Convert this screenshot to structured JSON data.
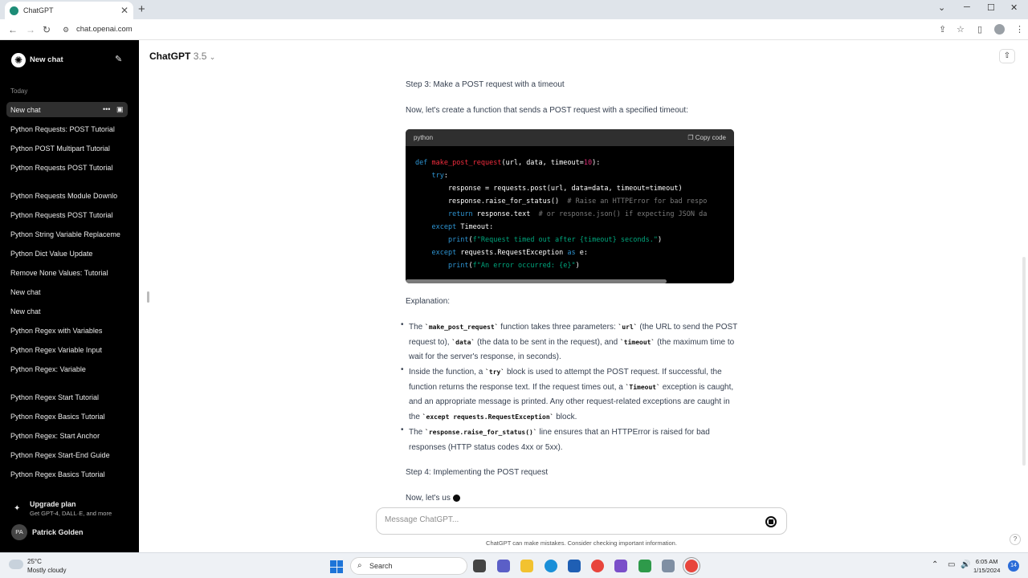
{
  "browser": {
    "tab_title": "ChatGPT",
    "tab_close": "✕",
    "new_tab": "+",
    "url": "chat.openai.com",
    "win_min": "─",
    "win_max": "☐",
    "win_close": "✕",
    "win_dropdown": "⌄"
  },
  "sidebar": {
    "logo": "✺",
    "new_chat_label": "New chat",
    "section_today": "Today",
    "items": [
      "New chat",
      "Python Requests: POST Tutorial",
      "Python POST Multipart Tutorial",
      "Python Requests POST Tutorial",
      "Python Requests Module Downlo",
      "Python Requests POST Tutorial",
      "Python String Variable Replaceme",
      "Python Dict Value Update",
      "Remove None Values: Tutorial",
      "New chat",
      "New chat",
      "Python Regex with Variables",
      "Python Regex Variable Input",
      "Python Regex: Variable",
      "Python Regex Start Tutorial",
      "Python Regex Basics Tutorial",
      "Python Regex: Start Anchor",
      "Python Regex Start-End Guide",
      "Python Regex Basics Tutorial"
    ],
    "upgrade_title": "Upgrade plan",
    "upgrade_sub": "Get GPT-4, DALL·E, and more",
    "user_initials": "PA",
    "user_name": "Patrick Golden"
  },
  "header": {
    "model_name": "ChatGPT",
    "model_version": "3.5"
  },
  "content": {
    "step3_heading": "Step 3: Make a POST request with a timeout",
    "step3_intro": "Now, let's create a function that sends a POST request with a specified timeout:",
    "code_lang": "python",
    "copy_label": "Copy code",
    "explanation_heading": "Explanation:",
    "step4_heading": "Step 4: Implementing the POST request",
    "streaming_text": "Now, let's us"
  },
  "composer": {
    "placeholder": "Message ChatGPT...",
    "disclaimer": "ChatGPT can make mistakes. Consider checking important information."
  },
  "taskbar": {
    "temperature": "25°C",
    "condition": "Mostly cloudy",
    "search_label": "Search",
    "time": "6:05 AM",
    "date": "1/15/2024",
    "notifications": "14"
  }
}
